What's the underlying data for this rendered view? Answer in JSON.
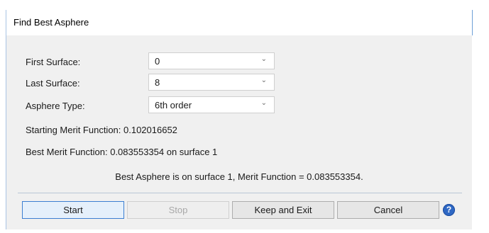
{
  "window": {
    "title": "Find Best Asphere"
  },
  "form": {
    "first_surface": {
      "label": "First Surface:",
      "value": "0"
    },
    "last_surface": {
      "label": "Last Surface:",
      "value": "8"
    },
    "asphere_type": {
      "label": "Asphere Type:",
      "value": "6th order"
    },
    "dropdown_icon": "chevron-down-icon"
  },
  "info": {
    "starting_merit": "Starting Merit Function: 0.102016652",
    "best_merit": "Best Merit Function: 0.083553354 on surface 1",
    "result": "Best Asphere is on surface 1, Merit Function = 0.083553354."
  },
  "buttons": {
    "start": "Start",
    "stop": "Stop",
    "keep_exit": "Keep and Exit",
    "cancel": "Cancel",
    "help": "?"
  },
  "colors": {
    "accent": "#3c7fd1",
    "help_icon": "#2f68c4"
  }
}
